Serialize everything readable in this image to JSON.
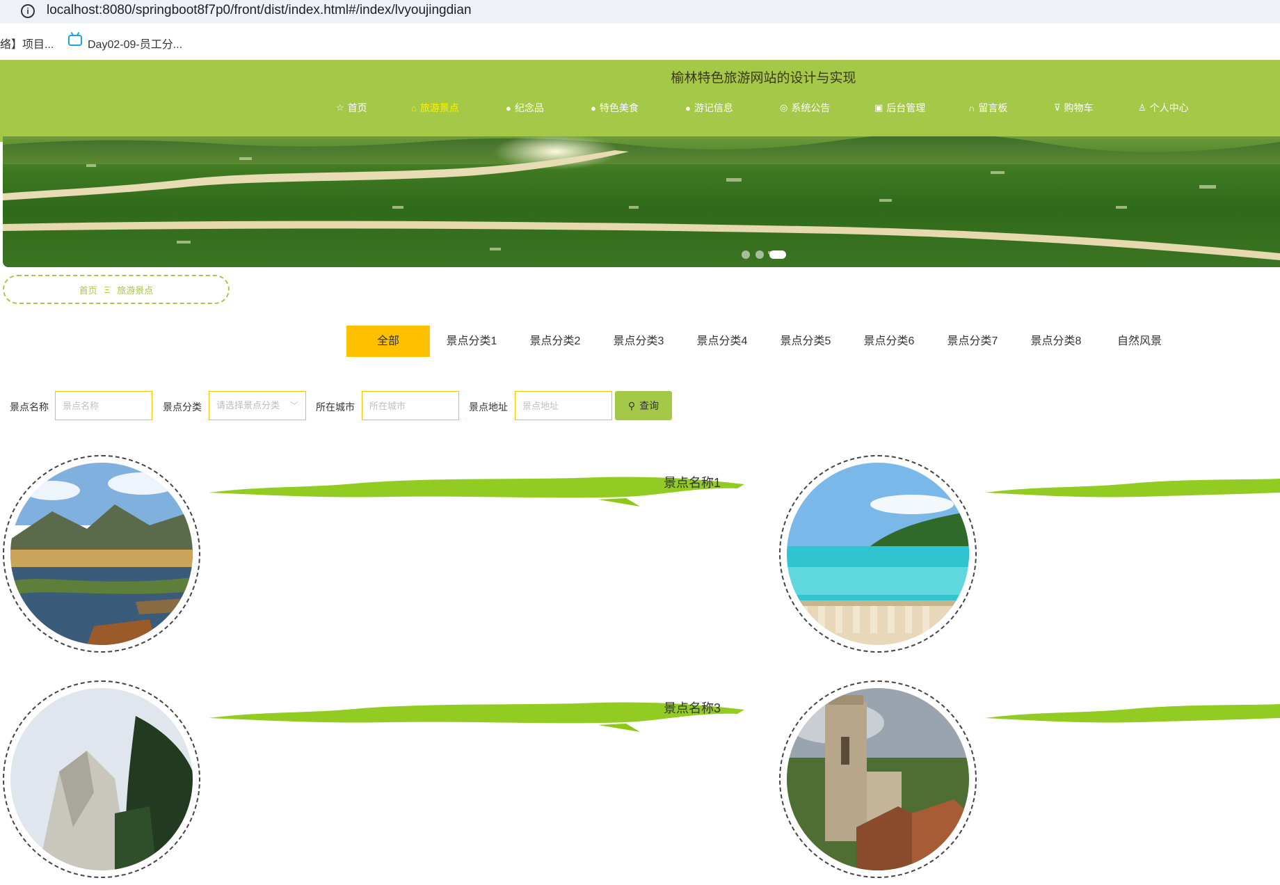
{
  "browser": {
    "url": "localhost:8080/springboot8f7p0/front/dist/index.html#/index/lvyoujingdian",
    "bookmarks": [
      {
        "label": "络】项目..."
      },
      {
        "label": "Day02-09-员工分..."
      }
    ]
  },
  "header": {
    "title": "榆林特色旅游网站的设计与实现",
    "bg_color": "#a4c847",
    "nav": [
      {
        "label": "首页",
        "icon": "star-icon"
      },
      {
        "label": "旅游景点",
        "icon": "bag-icon",
        "active": true
      },
      {
        "label": "纪念品",
        "icon": "info-icon"
      },
      {
        "label": "特色美食",
        "icon": "info-icon"
      },
      {
        "label": "游记信息",
        "icon": "info-icon"
      },
      {
        "label": "系统公告",
        "icon": "globe-icon"
      },
      {
        "label": "后台管理",
        "icon": "clipboard-icon"
      },
      {
        "label": "留言板",
        "icon": "headset-icon"
      },
      {
        "label": "购物车",
        "icon": "cart-icon"
      },
      {
        "label": "个人中心",
        "icon": "user-icon"
      }
    ]
  },
  "carousel": {
    "slide_count": 3,
    "active_index": 2
  },
  "breadcrumb": {
    "home": "首页",
    "separator": "Ξ",
    "current": "旅游景点"
  },
  "categories": {
    "items": [
      "全部",
      "景点分类1",
      "景点分类2",
      "景点分类3",
      "景点分类4",
      "景点分类5",
      "景点分类6",
      "景点分类7",
      "景点分类8",
      "自然风景"
    ],
    "active_index": 0,
    "active_color": "#ffc000"
  },
  "search": {
    "name_label": "景点名称",
    "name_placeholder": "景点名称",
    "category_label": "景点分类",
    "category_placeholder": "请选择景点分类",
    "city_label": "所在城市",
    "city_placeholder": "所在城市",
    "address_label": "景点地址",
    "address_placeholder": "景点地址",
    "button_label": "查询"
  },
  "spots": [
    {
      "name": "景点名称1",
      "scene": "lake"
    },
    {
      "name": "",
      "scene": "beach"
    },
    {
      "name": "景点名称3",
      "scene": "mountain"
    },
    {
      "name": "",
      "scene": "castle"
    }
  ]
}
